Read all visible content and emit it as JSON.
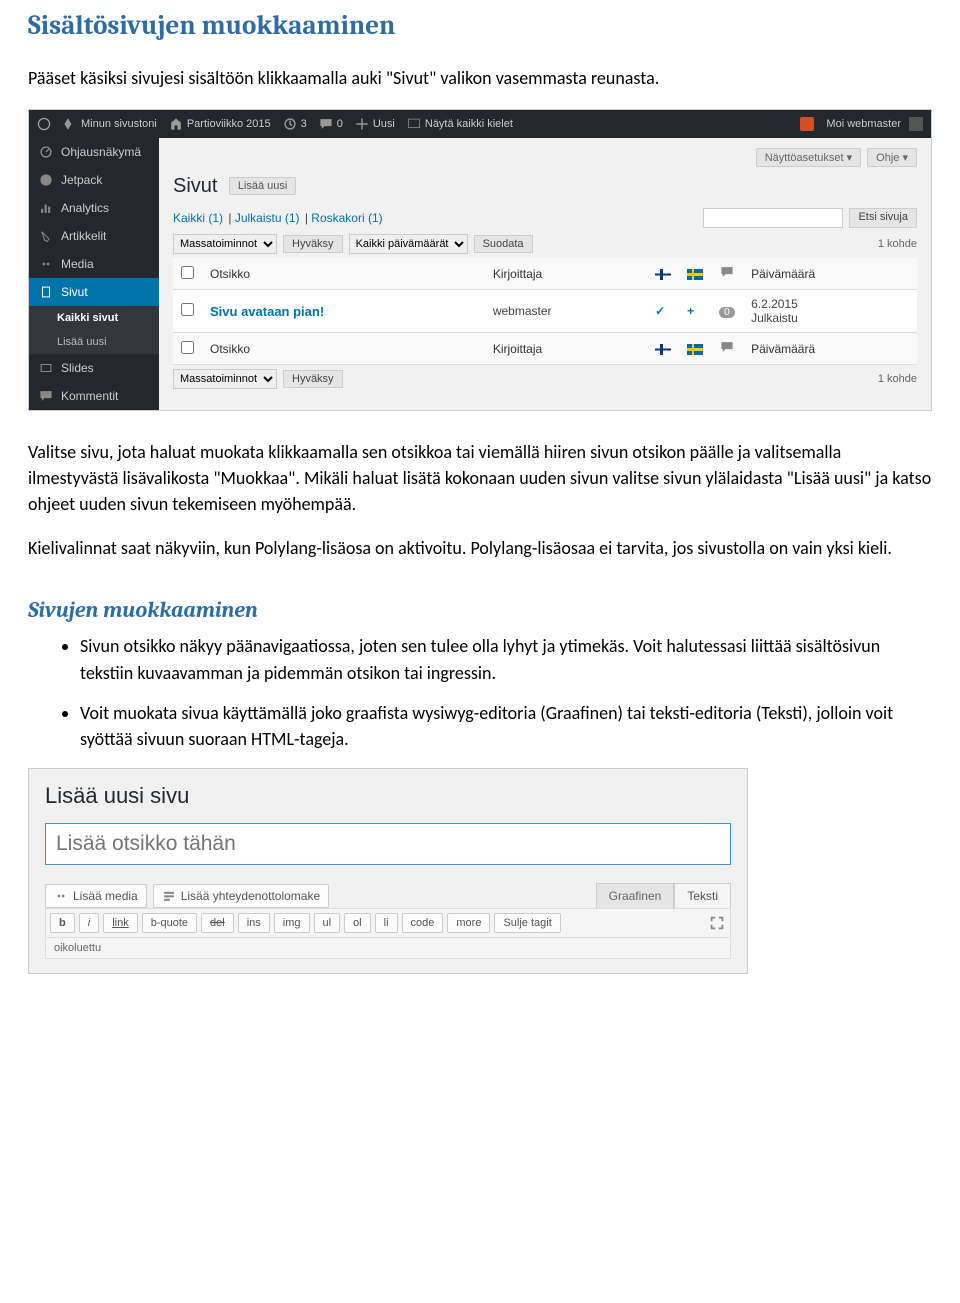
{
  "doc": {
    "title": "Sisältösivujen muokkaaminen",
    "intro": "Pääset käsiksi sivujesi sisältöön klikkaamalla auki \"Sivut\" valikon vasemmasta reunasta.",
    "para1": "Valitse sivu, jota haluat muokata klikkaamalla sen otsikkoa tai viemällä hiiren sivun otsikon päälle ja valitsemalla ilmestyvästä lisävalikosta \"Muokkaa\". Mikäli haluat lisätä kokonaan uuden sivun valitse sivun ylälaidasta \"Lisää uusi\" ja katso ohjeet uuden sivun tekemiseen myöhempää.",
    "para2": "Kielivalinnat saat näkyviin, kun Polylang-lisäosa on aktivoitu. Polylang-lisäosaa ei tarvita, jos sivustolla on vain yksi kieli.",
    "subheading": "Sivujen muokkaaminen",
    "bullets": [
      "Sivun otsikko näkyy päänavigaatiossa, joten sen tulee olla lyhyt ja ytimekäs. Voit halutessasi liittää sisältösivun tekstiin kuvaavamman ja pidemmän otsikon tai ingressin.",
      "Voit muokata sivua käyttämällä joko graafista wysiwyg-editoria (Graafinen) tai teksti-editoria (Teksti), jolloin voit syöttää sivuun suoraan HTML-tageja."
    ]
  },
  "shot1": {
    "topbar": {
      "my_sites": "Minun sivustoni",
      "site_name": "Partioviikko 2015",
      "updates": "3",
      "comments": "0",
      "new": "Uusi",
      "show_langs": "Näytä kaikki kielet",
      "user": "Moi webmaster"
    },
    "side": {
      "dashboard": "Ohjausnäkymä",
      "jetpack": "Jetpack",
      "analytics": "Analytics",
      "posts": "Artikkelit",
      "media": "Media",
      "pages": "Sivut",
      "all_pages": "Kaikki sivut",
      "add_new": "Lisää uusi",
      "slides": "Slides",
      "comments_m": "Kommentit"
    },
    "content": {
      "screen_options": "Näyttöasetukset ▾",
      "help": "Ohje ▾",
      "heading": "Sivut",
      "add_new_btn": "Lisää uusi",
      "filter_all": "Kaikki (1)",
      "filter_published": "Julkaistu (1)",
      "filter_trash": "Roskakori (1)",
      "search_btn": "Etsi sivuja",
      "bulk_action": "Massatoiminnot",
      "apply": "Hyväksy",
      "date_filter": "Kaikki päivämäärät",
      "filter_btn": "Suodata",
      "item_count": "1 kohde",
      "columns": {
        "title": "Otsikko",
        "author": "Kirjoittaja",
        "date": "Päivämäärä"
      },
      "row": {
        "title": "Sivu avataan pian!",
        "author": "webmaster",
        "date": "6.2.2015",
        "status": "Julkaistu",
        "comments": "0"
      }
    }
  },
  "shot2": {
    "heading": "Lisää uusi sivu",
    "title_placeholder": "Lisää otsikko tähän",
    "add_media": "Lisää media",
    "add_form": "Lisää yhteydenottolomake",
    "tab_visual": "Graafinen",
    "tab_text": "Teksti",
    "toolbar": [
      "b",
      "i",
      "link",
      "b-quote",
      "del",
      "ins",
      "img",
      "ul",
      "ol",
      "li",
      "code",
      "more",
      "Sulje tagit"
    ],
    "line2": "oikoluettu"
  }
}
